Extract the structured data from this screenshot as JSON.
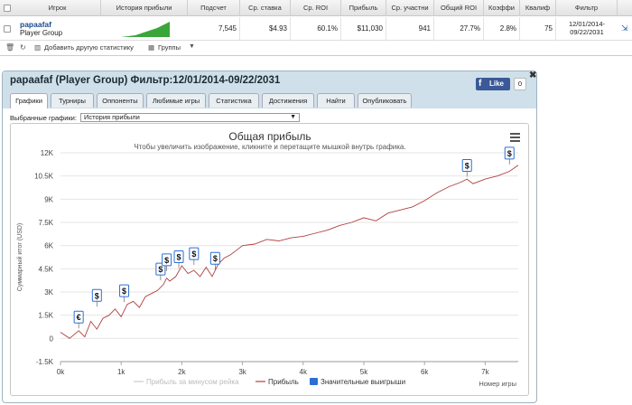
{
  "table": {
    "headers": [
      "Игрок",
      "История прибыли",
      "Подсчет",
      "Ср. ставка",
      "Ср. ROI",
      "Прибыль",
      "Ср. участни",
      "Общий ROI",
      "Коэффи",
      "Квалиф",
      "Фильтр"
    ],
    "row": {
      "player": "papaafaf",
      "group": "Player Group",
      "count": "7,545",
      "avg_stake": "$4.93",
      "avg_roi": "60.1%",
      "profit": "$11,030",
      "avg_entrants": "941",
      "total_roi": "27.7%",
      "coef": "2.8%",
      "qualif": "75",
      "filter_line1": "12/01/2014-",
      "filter_line2": "09/22/2031"
    }
  },
  "toolbar": {
    "add_stats": "Добавить другую статистику",
    "groups": "Группы"
  },
  "panel": {
    "title": "papaafaf (Player Group) Фильтр:12/01/2014-09/22/2031",
    "tabs": [
      "Графики",
      "Турниры",
      "Оппоненты",
      "Любимые игры",
      "Статистика",
      "Достижения",
      "Найти",
      "Опубликовать"
    ],
    "active_tab": "Графики",
    "fb_like": "Like",
    "fb_count": "0",
    "select_label": "Выбранные графики:",
    "select_value": "История прибыли"
  },
  "chart_data": {
    "type": "line",
    "title": "Общая прибыль",
    "subtitle": "Чтобы увеличить изображение, кликните и перетащите мышкой внутрь графика.",
    "ylabel": "Суммарный итог (USD)",
    "xlabel": "Номер игры",
    "ylim": [
      -1500,
      12000
    ],
    "xlim": [
      0,
      7545
    ],
    "yticks": [
      "-1.5K",
      "0",
      "1.5K",
      "3K",
      "4.5K",
      "6K",
      "7.5K",
      "9K",
      "10.5K",
      "12K"
    ],
    "xticks": [
      "0k",
      "1k",
      "2k",
      "3k",
      "4k",
      "5k",
      "6k",
      "7k"
    ],
    "legend": [
      {
        "name": "Прибыль за минусом рейка",
        "color": "#cccccc"
      },
      {
        "name": "Прибыль",
        "color": "#b04040"
      },
      {
        "name": "Значительные выигрыши",
        "color": "#2b6fd6"
      }
    ],
    "series": [
      {
        "name": "Прибыль",
        "color": "#b04040",
        "x": [
          0,
          150,
          300,
          400,
          500,
          600,
          700,
          800,
          900,
          1000,
          1100,
          1200,
          1300,
          1400,
          1500,
          1600,
          1700,
          1750,
          1800,
          1900,
          2000,
          2100,
          2200,
          2300,
          2400,
          2500,
          2600,
          2700,
          2800,
          2900,
          3000,
          3200,
          3400,
          3600,
          3800,
          4000,
          4200,
          4400,
          4600,
          4800,
          5000,
          5200,
          5400,
          5600,
          5800,
          6000,
          6200,
          6400,
          6600,
          6700,
          6800,
          7000,
          7200,
          7400,
          7545
        ],
        "y": [
          400,
          0,
          500,
          100,
          1100,
          600,
          1300,
          1500,
          1900,
          1400,
          2200,
          2400,
          2000,
          2700,
          2900,
          3100,
          3500,
          3900,
          3700,
          4000,
          4700,
          4200,
          4400,
          4000,
          4600,
          4000,
          4800,
          5200,
          5400,
          5700,
          6000,
          6100,
          6400,
          6300,
          6500,
          6600,
          6800,
          7000,
          7300,
          7500,
          7800,
          7600,
          8100,
          8300,
          8500,
          8900,
          9400,
          9800,
          10100,
          10300,
          10000,
          10300,
          10500,
          10800,
          11200
        ]
      }
    ],
    "markers": [
      {
        "x": 300,
        "y": 1000,
        "symbol": "€"
      },
      {
        "x": 600,
        "y": 2400,
        "symbol": "$"
      },
      {
        "x": 1050,
        "y": 2700,
        "symbol": "$"
      },
      {
        "x": 1650,
        "y": 4100,
        "symbol": "$"
      },
      {
        "x": 1750,
        "y": 4700,
        "symbol": "$"
      },
      {
        "x": 1950,
        "y": 4900,
        "symbol": "$"
      },
      {
        "x": 2200,
        "y": 5100,
        "symbol": "$"
      },
      {
        "x": 2550,
        "y": 4800,
        "symbol": "$"
      },
      {
        "x": 6700,
        "y": 10800,
        "symbol": "$"
      },
      {
        "x": 7400,
        "y": 11600,
        "symbol": "$"
      }
    ]
  }
}
